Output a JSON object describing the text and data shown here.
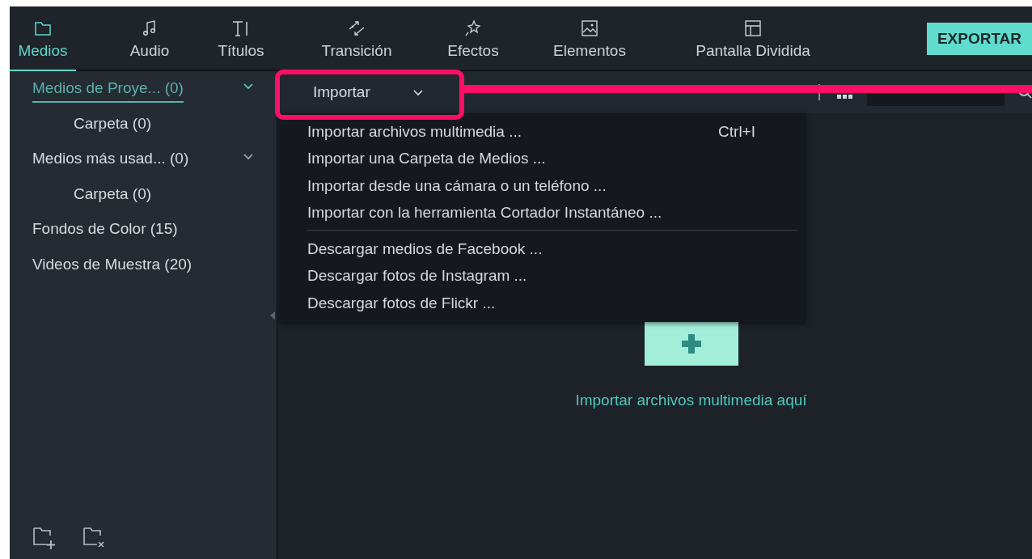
{
  "tabs": [
    {
      "label": "Medios",
      "kind": "folder",
      "selected": true
    },
    {
      "label": "Audio",
      "kind": "music",
      "selected": false
    },
    {
      "label": "Títulos",
      "kind": "title",
      "selected": false
    },
    {
      "label": "Transición",
      "kind": "transition",
      "selected": false
    },
    {
      "label": "Efectos",
      "kind": "effects",
      "selected": false
    },
    {
      "label": "Elementos",
      "kind": "image",
      "selected": false
    },
    {
      "label": "Pantalla Dividida",
      "kind": "split",
      "selected": false
    }
  ],
  "export_button": "EXPORTAR",
  "sidebar": {
    "items": [
      {
        "label": "Medios de Proye... (0)",
        "selected": true,
        "expanded": true,
        "children": [
          {
            "label": "Carpeta (0)",
            "selected": false
          }
        ]
      },
      {
        "label": "Medios más usad... (0)",
        "selected": false,
        "expanded": true,
        "children": [
          {
            "label": "Carpeta (0)",
            "selected": false
          }
        ]
      },
      {
        "label": "Fondos de Color (15)",
        "selected": false
      },
      {
        "label": "Videos de Muestra (20)",
        "selected": false
      }
    ]
  },
  "toolbar": {
    "import_button": "Importar"
  },
  "import_menu": {
    "groups": [
      [
        {
          "label": "Importar archivos multimedia ...",
          "shortcut": "Ctrl+I"
        },
        {
          "label": "Importar una Carpeta de Medios ..."
        },
        {
          "label": "Importar desde una cámara o un teléfono ..."
        },
        {
          "label": "Importar con la herramienta Cortador Instantáneo ..."
        }
      ],
      [
        {
          "label": "Descargar medios de Facebook ..."
        },
        {
          "label": "Descargar fotos de Instagram ..."
        },
        {
          "label": "Descargar fotos de Flickr ..."
        }
      ]
    ]
  },
  "drop_zone": {
    "hint": "Importar archivos multimedia aquí"
  }
}
